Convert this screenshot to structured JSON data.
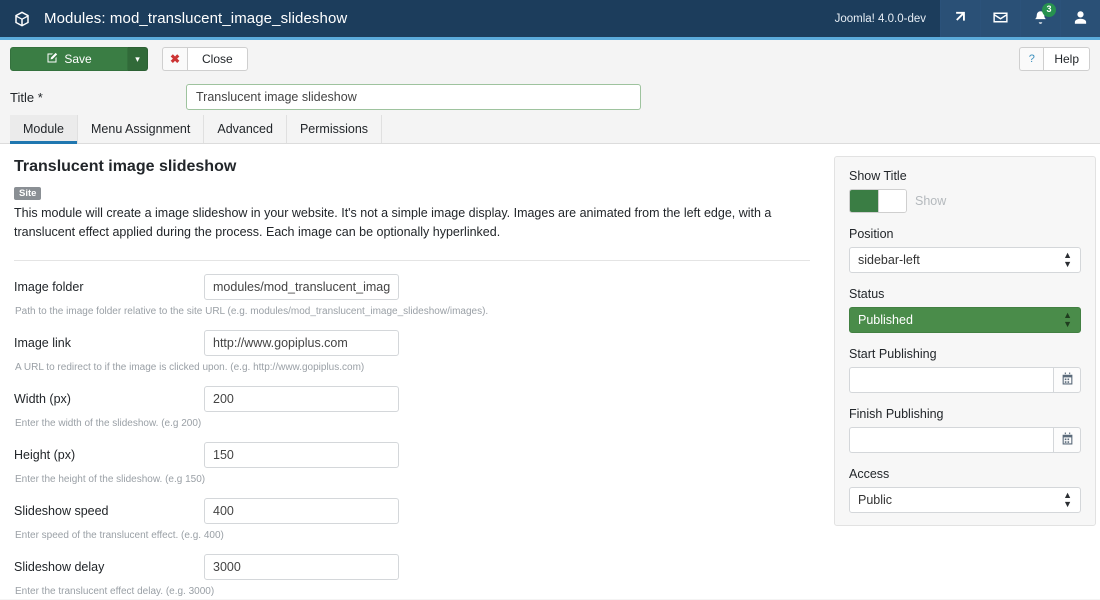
{
  "topbar": {
    "title": "Modules: mod_translucent_image_slideshow",
    "version": "Joomla! 4.0.0-dev",
    "notification_count": "3"
  },
  "toolbar": {
    "save_label": "Save",
    "save_caret": "▾",
    "close_x": "✖",
    "close_label": "Close",
    "help_q": "?",
    "help_label": "Help"
  },
  "title_field": {
    "label": "Title *",
    "value": "Translucent image slideshow",
    "placeholder": "Title"
  },
  "tabs": [
    {
      "label": "Module",
      "active": true
    },
    {
      "label": "Menu Assignment",
      "active": false
    },
    {
      "label": "Advanced",
      "active": false
    },
    {
      "label": "Permissions",
      "active": false
    }
  ],
  "module": {
    "heading": "Translucent image slideshow",
    "badge": "Site",
    "description": "This module will create a image slideshow in your website. It's not a simple image display. Images are animated from the left edge, with a translucent effect applied during the process. Each image can be optionally hyperlinked."
  },
  "fields": [
    {
      "label": "Image folder",
      "value": "modules/mod_translucent_image_slideshow/images",
      "help": "Path to the image folder relative to the site URL (e.g. modules/mod_translucent_image_slideshow/images)."
    },
    {
      "label": "Image link",
      "value": "http://www.gopiplus.com",
      "help": "A URL to redirect to if the image is clicked upon. (e.g. http://www.gopiplus.com)"
    },
    {
      "label": "Width (px)",
      "value": "200",
      "help": "Enter the width of the slideshow. (e.g 200)"
    },
    {
      "label": "Height (px)",
      "value": "150",
      "help": "Enter the height of the slideshow. (e.g 150)"
    },
    {
      "label": "Slideshow speed",
      "value": "400",
      "help": "Enter speed of the translucent effect. (e.g. 400)"
    },
    {
      "label": "Slideshow delay",
      "value": "3000",
      "help": "Enter the translucent effect delay. (e.g. 3000)"
    }
  ],
  "sidebar": {
    "show_title": {
      "label": "Show Title",
      "state_text": "Show"
    },
    "position": {
      "label": "Position",
      "value": "sidebar-left"
    },
    "status": {
      "label": "Status",
      "value": "Published"
    },
    "start_publishing": {
      "label": "Start Publishing",
      "value": "",
      "placeholder": ""
    },
    "finish_publishing": {
      "label": "Finish Publishing",
      "value": "",
      "placeholder": ""
    },
    "access": {
      "label": "Access",
      "value": "Public"
    }
  },
  "colors": {
    "topbar": "#1c3d5c",
    "topbar_accent": "#5babdb",
    "save_green": "#3a7d44",
    "status_green": "#4a8c4a",
    "tab_active": "#2077b0",
    "badge_green": "#27914f",
    "close_red": "#cc3333"
  }
}
